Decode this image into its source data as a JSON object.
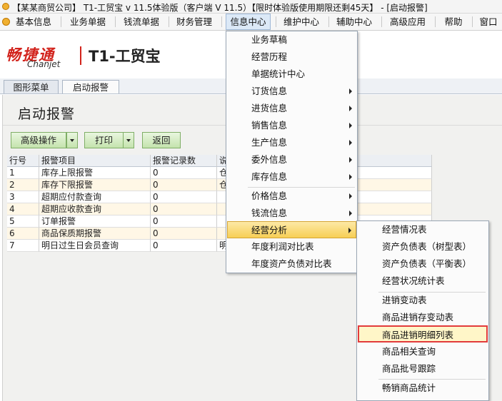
{
  "window": {
    "title": "【某某商贸公司】 T1-工贸宝 v 11.5体验版（客户端 V 11.5）【限时体验版使用期限还剩45天】 - [启动报警]"
  },
  "menubar": {
    "items": [
      {
        "label": "基本信息"
      },
      {
        "label": "业务单据"
      },
      {
        "label": "钱流单据"
      },
      {
        "label": "财务管理"
      },
      {
        "label": "信息中心"
      },
      {
        "label": "维护中心"
      },
      {
        "label": "辅助中心"
      },
      {
        "label": "高级应用"
      },
      {
        "label": "帮助"
      },
      {
        "label": "窗口"
      }
    ]
  },
  "logo": {
    "cn": "畅捷通",
    "en": "Chanjet",
    "product": "T1-工贸宝"
  },
  "tabs": [
    {
      "label": "图形菜单"
    },
    {
      "label": "启动报警"
    }
  ],
  "page": {
    "title": "启动报警",
    "buttons": {
      "advanced": "高级操作",
      "print": "打印",
      "back": "返回"
    }
  },
  "table": {
    "columns": [
      "行号",
      "报警项目",
      "报警记录数",
      "说"
    ],
    "rows": [
      {
        "no": "1",
        "item": "库存上限报警",
        "count": "0",
        "desc": "仓"
      },
      {
        "no": "2",
        "item": "库存下限报警",
        "count": "0",
        "desc": "仓"
      },
      {
        "no": "3",
        "item": "超期应付款查询",
        "count": "0",
        "desc": ""
      },
      {
        "no": "4",
        "item": "超期应收款查询",
        "count": "0",
        "desc": ""
      },
      {
        "no": "5",
        "item": "订单报警",
        "count": "0",
        "desc": ""
      },
      {
        "no": "6",
        "item": "商品保质期报警",
        "count": "0",
        "desc": ""
      },
      {
        "no": "7",
        "item": "明日过生日会员查询",
        "count": "0",
        "desc": "明"
      }
    ]
  },
  "info_menu": {
    "items": [
      {
        "label": "业务草稿"
      },
      {
        "label": "经营历程"
      },
      {
        "label": "单据统计中心"
      },
      {
        "label": "订货信息"
      },
      {
        "label": "进货信息"
      },
      {
        "label": "销售信息"
      },
      {
        "label": "生产信息"
      },
      {
        "label": "委外信息"
      },
      {
        "label": "库存信息"
      },
      {
        "label": "价格信息"
      },
      {
        "label": "钱流信息"
      },
      {
        "label": "经营分析"
      },
      {
        "label": "年度利润对比表"
      },
      {
        "label": "年度资产负债对比表"
      }
    ]
  },
  "analysis_menu": {
    "items": [
      {
        "label": "经营情况表"
      },
      {
        "label": "资产负债表（树型表）"
      },
      {
        "label": "资产负债表（平衡表）"
      },
      {
        "label": "经营状况统计表"
      },
      {
        "label": "进销变动表"
      },
      {
        "label": "商品进销存变动表"
      },
      {
        "label": "商品进销明细列表"
      },
      {
        "label": "商品相关查询"
      },
      {
        "label": "商品批号跟踪"
      },
      {
        "label": "畅销商品统计"
      }
    ]
  },
  "colors": {
    "logo_red": "#d2231c",
    "menu_highlight": "#f7cf55",
    "selection_border": "#e23b3b",
    "button_green": "#c4e3ad"
  }
}
